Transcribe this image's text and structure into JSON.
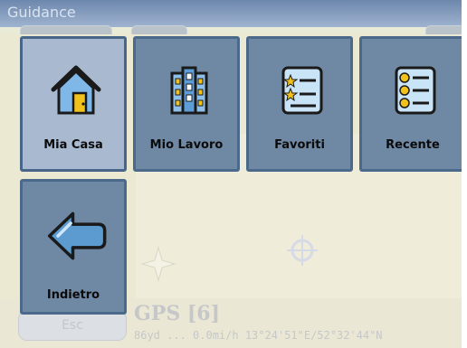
{
  "window": {
    "title": "Guidance"
  },
  "menu": {
    "tiles": [
      {
        "label": "Mia Casa",
        "icon": "house-icon",
        "selected": true
      },
      {
        "label": "Mio Lavoro",
        "icon": "office-building-icon",
        "selected": false
      },
      {
        "label": "Favoriti",
        "icon": "favorites-list-icon",
        "selected": false
      },
      {
        "label": "Recente",
        "icon": "recent-list-icon",
        "selected": false
      },
      {
        "label": "Indietro",
        "icon": "back-arrow-icon",
        "selected": false
      }
    ]
  },
  "status": {
    "exit_label": "Esc",
    "gps_label": "GPS [6]",
    "readout": "86yd ... 0.0mi/h  13°24'51\"E/52°32'44\"N"
  },
  "colors": {
    "tile_bg": "#6f88a4",
    "tile_selected_bg": "#a9bad0",
    "tile_border": "#4b6a8b",
    "map_bg": "#ece9d2"
  }
}
